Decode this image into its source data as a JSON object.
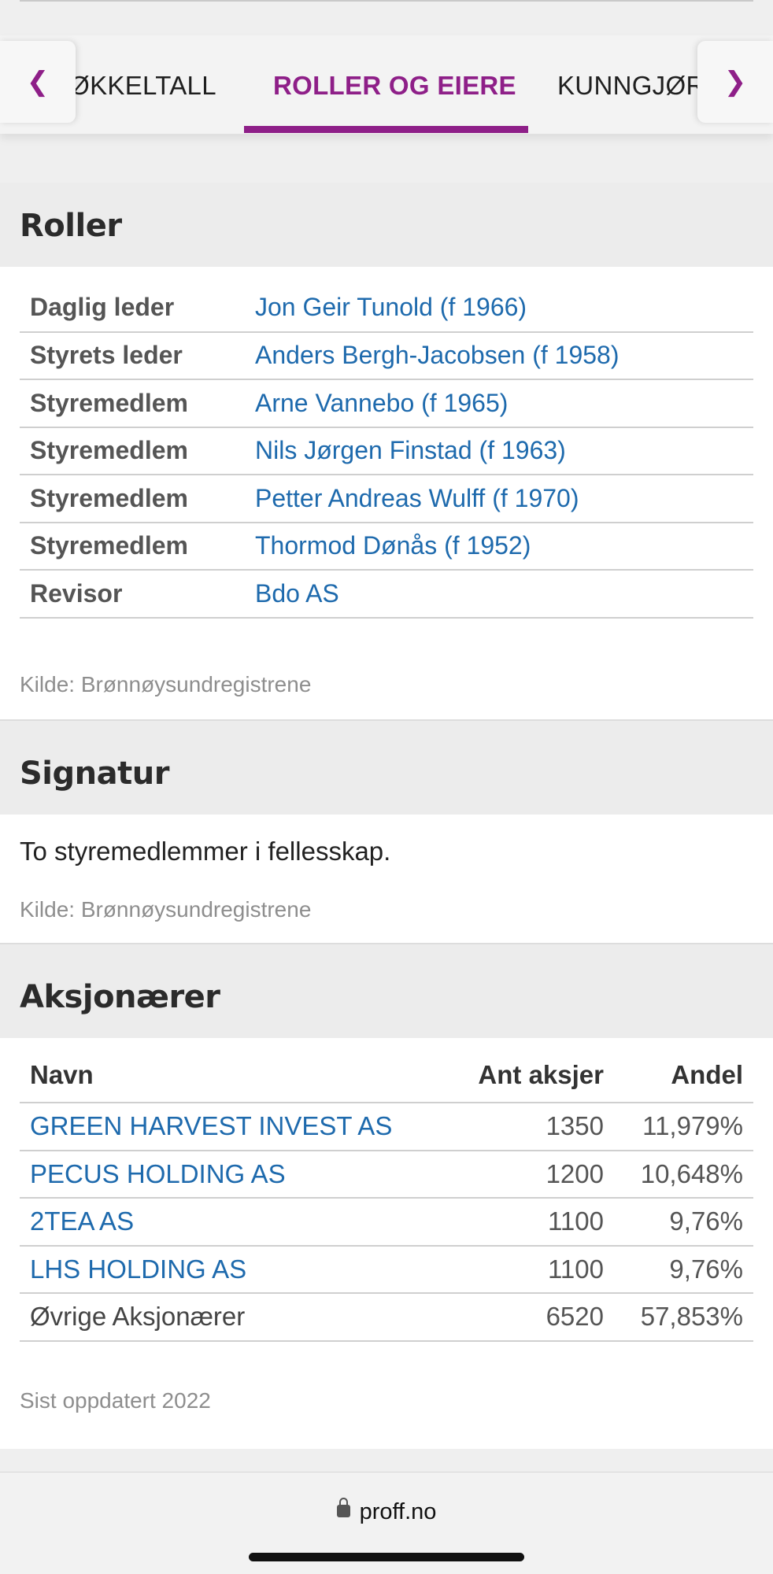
{
  "tabs": {
    "items": [
      {
        "label": "NØKKELTALL"
      },
      {
        "label": "ROLLER OG EIERE"
      },
      {
        "label": "KUNNGJØRINGER"
      }
    ],
    "prev_icon": "chevron-left-icon",
    "next_icon": "chevron-right-icon",
    "accent_color": "#8e1f88"
  },
  "roles": {
    "title": "Roller",
    "rows": [
      {
        "role": "Daglig leder",
        "person": "Jon Geir Tunold (f 1966)"
      },
      {
        "role": "Styrets leder",
        "person": "Anders Bergh-Jacobsen (f 1958)"
      },
      {
        "role": "Styremedlem",
        "person": "Arne Vannebo (f 1965)"
      },
      {
        "role": "Styremedlem",
        "person": "Nils Jørgen Finstad (f 1963)"
      },
      {
        "role": "Styremedlem",
        "person": "Petter Andreas Wulff (f 1970)"
      },
      {
        "role": "Styremedlem",
        "person": "Thormod Dønås (f 1952)"
      },
      {
        "role": "Revisor",
        "person": "Bdo AS"
      }
    ],
    "source": "Kilde: Brønnøysundregistrene"
  },
  "signature": {
    "title": "Signatur",
    "text": "To styremedlemmer i fellesskap.",
    "source": "Kilde: Brønnøysundregistrene"
  },
  "shareholders": {
    "title": "Aksjonærer",
    "columns": {
      "name": "Navn",
      "shares": "Ant aksjer",
      "share_pct": "Andel"
    },
    "rows": [
      {
        "name": "GREEN HARVEST INVEST AS",
        "shares": "1350",
        "pct": "11,979%",
        "link": true
      },
      {
        "name": "PECUS HOLDING AS",
        "shares": "1200",
        "pct": "10,648%",
        "link": true
      },
      {
        "name": "2TEA AS",
        "shares": "1100",
        "pct": "9,76%",
        "link": true
      },
      {
        "name": "LHS HOLDING AS",
        "shares": "1100",
        "pct": "9,76%",
        "link": true
      },
      {
        "name": "Øvrige Aksjonærer",
        "shares": "6520",
        "pct": "57,853%",
        "link": false
      }
    ],
    "updated": "Sist oppdatert 2022"
  },
  "browser": {
    "url": "proff.no",
    "lock_icon": "lock-icon"
  },
  "colors": {
    "link": "#1e6aad",
    "accent": "#8e1f88"
  }
}
